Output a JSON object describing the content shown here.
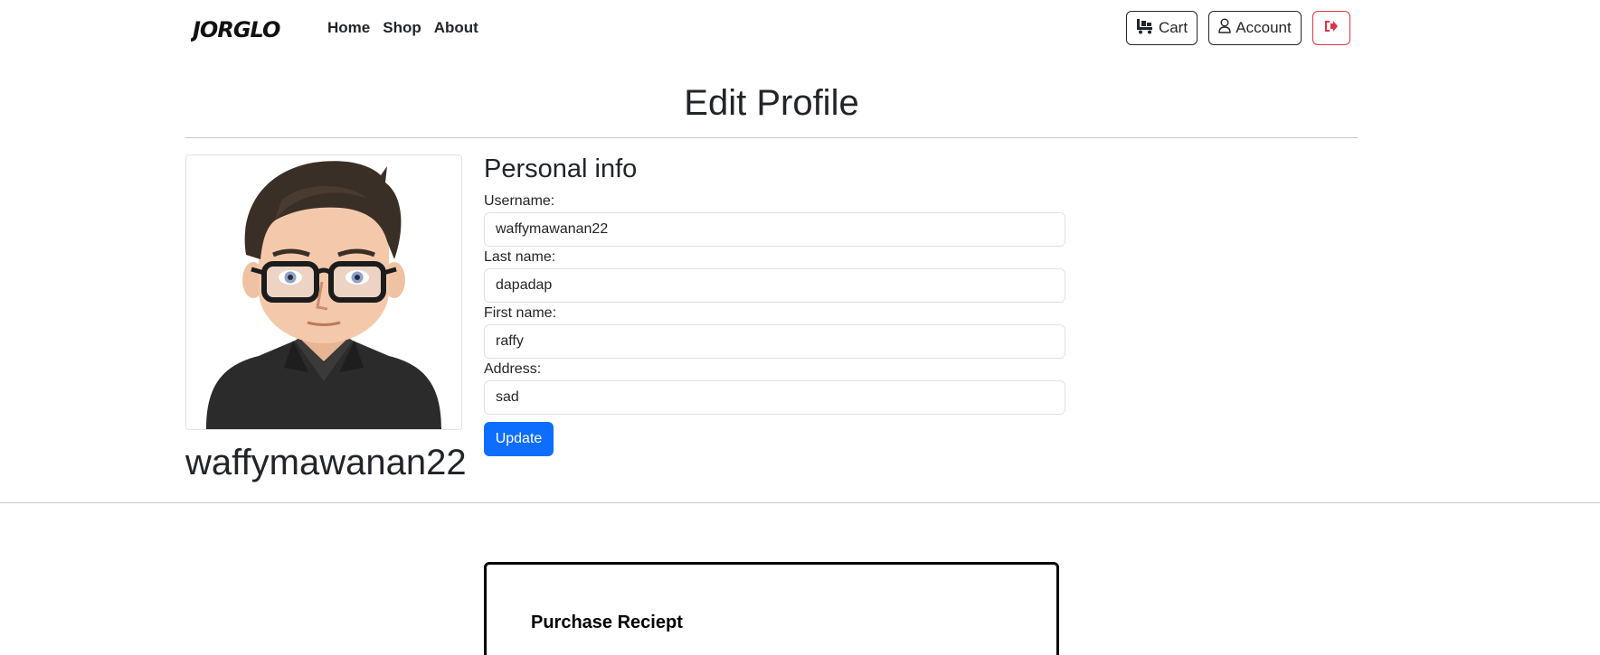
{
  "nav": {
    "brand": "JORGLO",
    "links": [
      {
        "label": "Home"
      },
      {
        "label": "Shop"
      },
      {
        "label": "About"
      }
    ],
    "cart_label": "Cart",
    "account_label": "Account",
    "logout_icon": "logout-icon"
  },
  "page": {
    "title": "Edit Profile"
  },
  "profile": {
    "display_name": "waffymawanan22",
    "avatar_icon": "user-avatar-cartoon"
  },
  "form": {
    "section_title": "Personal info",
    "fields": [
      {
        "label": "Username:",
        "value": "waffymawanan22"
      },
      {
        "label": "Last name:",
        "value": "dapadap"
      },
      {
        "label": "First name:",
        "value": "raffy"
      },
      {
        "label": "Address:",
        "value": "sad"
      }
    ],
    "submit_label": "Update"
  },
  "receipt": {
    "title": "Purchase Reciept"
  },
  "colors": {
    "primary": "#0d6efd",
    "danger": "#dc3545",
    "text": "#212529"
  }
}
